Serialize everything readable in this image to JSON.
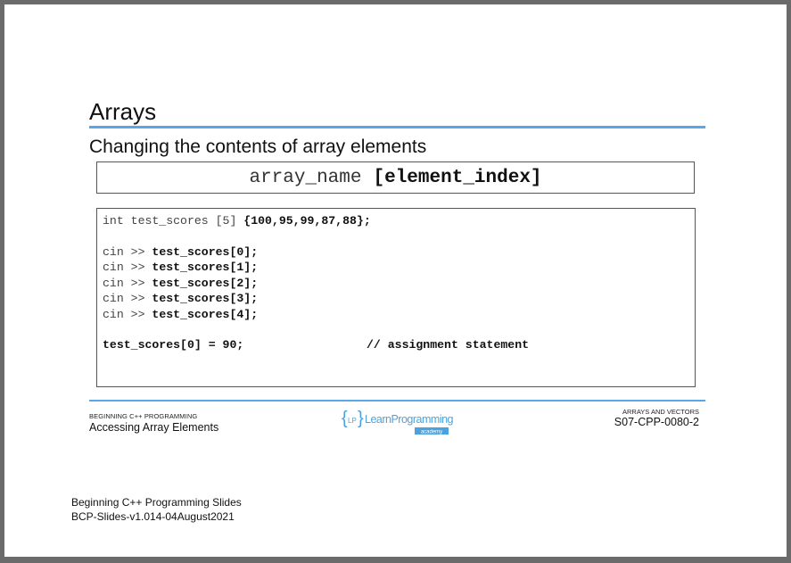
{
  "slide": {
    "title": "Arrays",
    "subtitle": "Changing the contents of array elements",
    "syntax_plain": "array_name",
    "syntax_bold": "[element_index]"
  },
  "code": {
    "line1_plain": "int test_scores [5] ",
    "line1_bold": "{100,95,99,87,88};",
    "cin_prefix": "cin >> ",
    "cin_lines": [
      "test_scores[0];",
      "test_scores[1];",
      "test_scores[2];",
      "test_scores[3];",
      "test_scores[4];"
    ],
    "assign": "test_scores[0] = 90;",
    "comment": "// assignment statement"
  },
  "footer": {
    "left_small": "BEGINNING C++ PROGRAMMING",
    "left_big": "Accessing Array Elements",
    "logo_brace_text": "LP",
    "logo_text": "LearnProgramming",
    "logo_sub": "academy",
    "right_small": "ARRAYS AND VECTORS",
    "right_big": "S07-CPP-0080-2"
  },
  "bottom": {
    "line1": "Beginning C++ Programming Slides",
    "line2": "BCP-Slides-v1.014-04August2021"
  },
  "colors": {
    "accent": "#5aa6e6"
  }
}
